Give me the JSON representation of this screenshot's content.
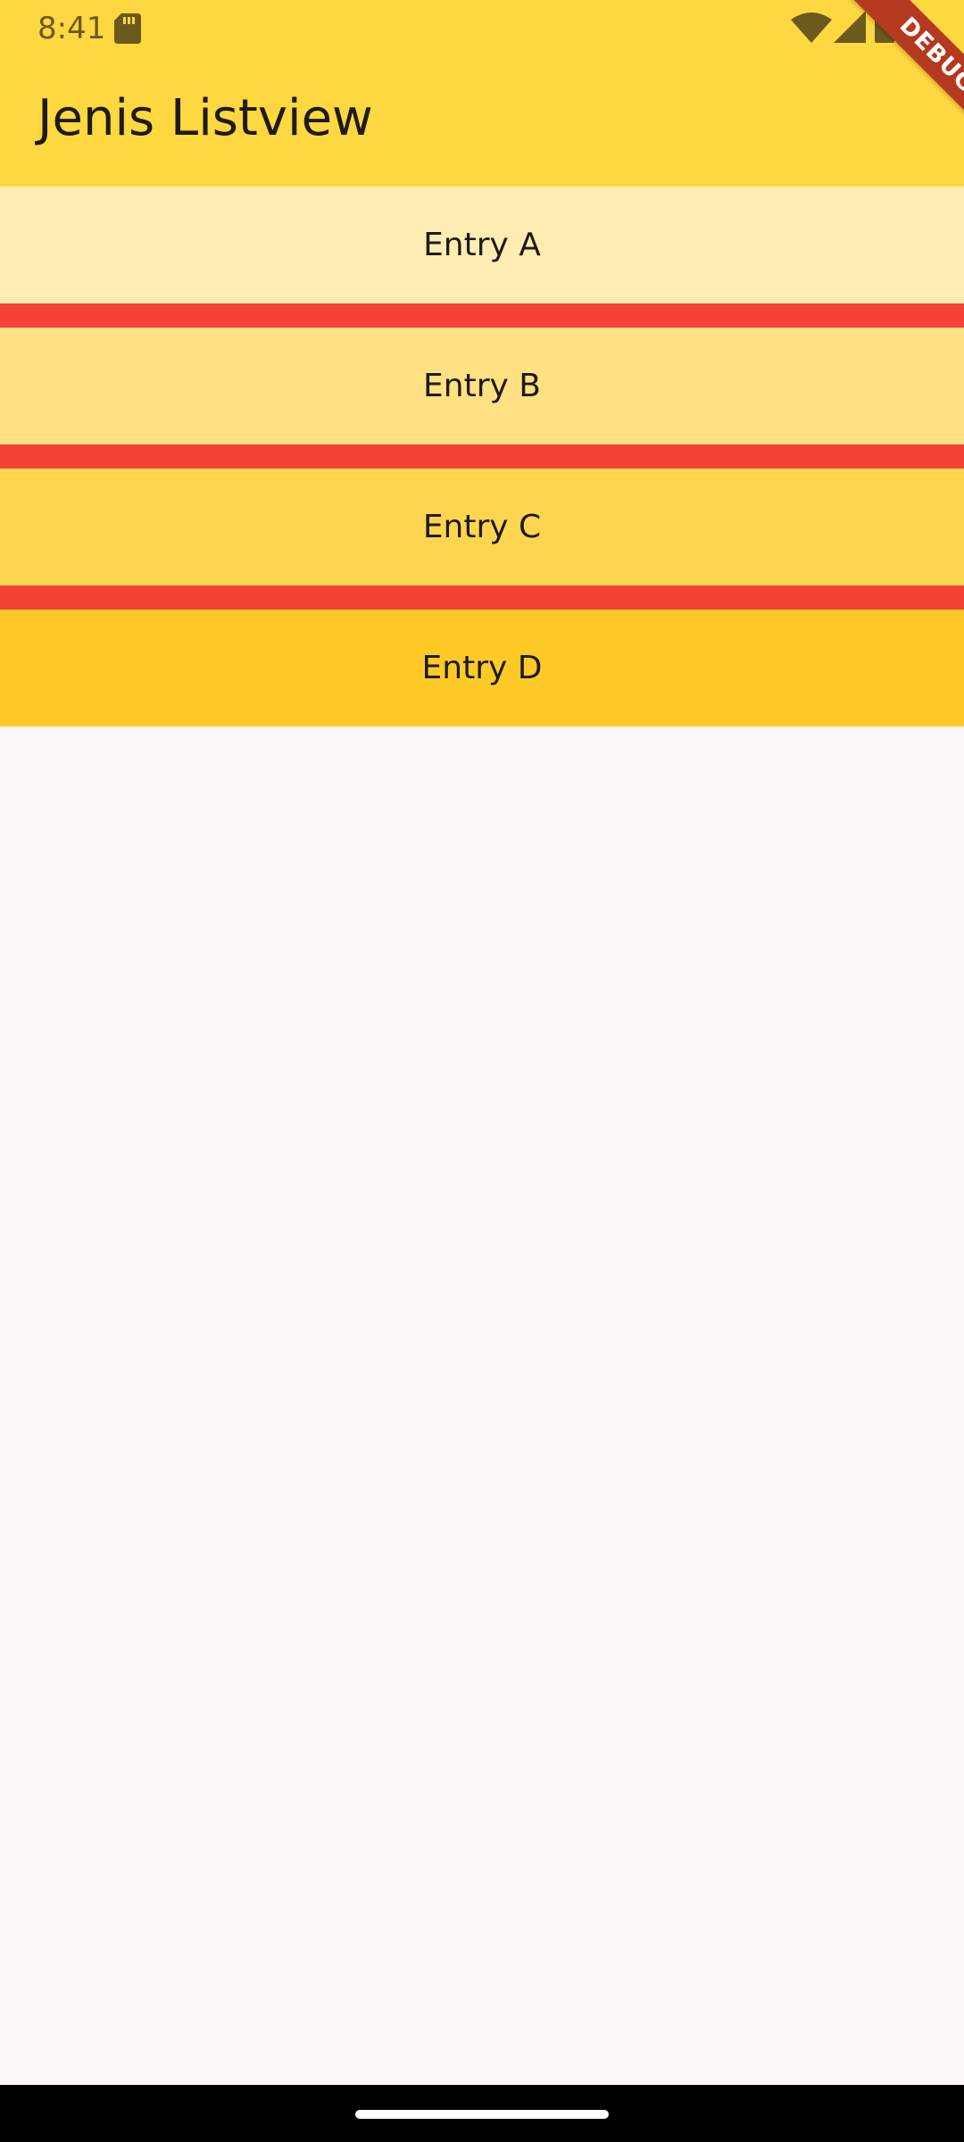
{
  "status_bar": {
    "time": "8:41"
  },
  "app_bar": {
    "title": "Jenis Listview",
    "background": "#FFD740"
  },
  "debug_banner": {
    "label": "DEBUG",
    "color": "#B4391E"
  },
  "list": {
    "separator_color": "#F44336",
    "items": [
      {
        "label": "Entry A",
        "color": "#FFECB3"
      },
      {
        "label": "Entry B",
        "color": "#FFE082"
      },
      {
        "label": "Entry C",
        "color": "#FFD54F"
      },
      {
        "label": "Entry D",
        "color": "#FFCA28"
      }
    ]
  },
  "icons": {
    "sd_card": "sd-card-icon",
    "wifi": "wifi-icon",
    "signal": "cell-signal-icon",
    "battery": "battery-icon"
  }
}
